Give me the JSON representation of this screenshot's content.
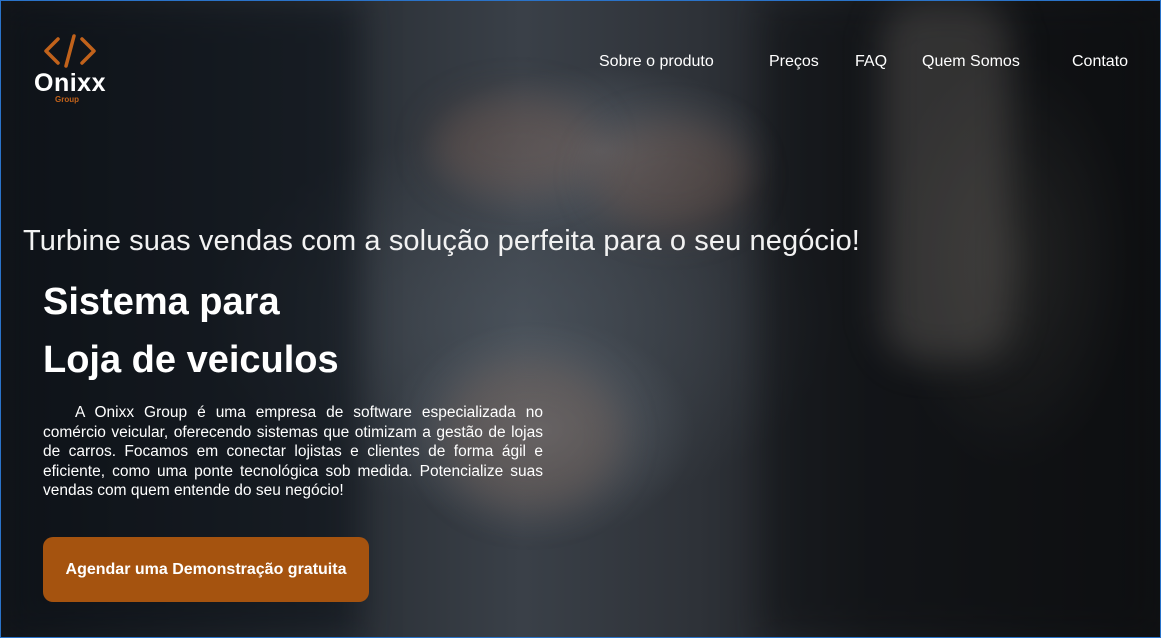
{
  "brand": {
    "name": "Onixx",
    "sub": "Group",
    "accent": "#c1621b"
  },
  "nav": {
    "items": [
      {
        "label": "Sobre o produto"
      },
      {
        "label": "Preços"
      },
      {
        "label": "FAQ"
      },
      {
        "label": "Quem Somos"
      },
      {
        "label": "Contato"
      }
    ]
  },
  "hero": {
    "tagline": "Turbine suas vendas com a solução perfeita para o seu negócio!",
    "title_line1": "Sistema para",
    "title_line2": "Loja de veiculos",
    "description": "A Onixx Group é uma empresa de software especializada no comércio veicular, oferecendo sistemas que otimizam a gestão de lojas de carros. Focamos em conectar lojistas e clientes de forma ágil e eficiente, como uma ponte tecnológica sob medida. Potencialize suas vendas com quem entende do seu negócio!",
    "cta_label": "Agendar uma Demonstração gratuita",
    "cta_color": "#a5530f",
    "background_image": "handshake-car-keys-photo"
  }
}
